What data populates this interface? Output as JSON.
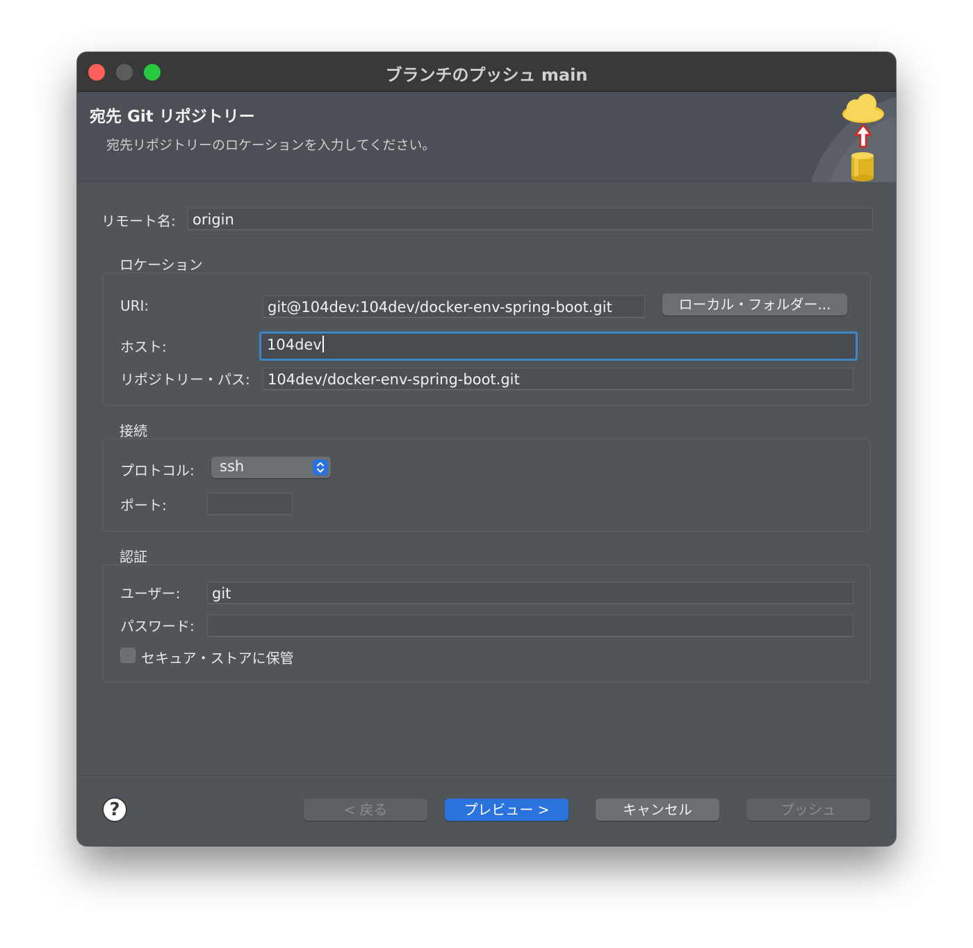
{
  "window": {
    "title": "ブランチのプッシュ main"
  },
  "header": {
    "title": "宛先 Git リポジトリー",
    "description": "宛先リポジトリーのロケーションを入力してください。"
  },
  "remote": {
    "label": "リモート名:",
    "value": "origin"
  },
  "location": {
    "group_title": "ロケーション",
    "uri_label": "URI:",
    "uri_value": "git@104dev:104dev/docker-env-spring-boot.git",
    "local_folder_button": "ローカル・フォルダー...",
    "host_label": "ホスト:",
    "host_value": "104dev",
    "repo_path_label": "リポジトリー・パス:",
    "repo_path_value": "104dev/docker-env-spring-boot.git"
  },
  "connection": {
    "group_title": "接続",
    "protocol_label": "プロトコル:",
    "protocol_value": "ssh",
    "port_label": "ポート:",
    "port_value": ""
  },
  "auth": {
    "group_title": "認証",
    "user_label": "ユーザー:",
    "user_value": "git",
    "password_label": "パスワード:",
    "password_value": "",
    "secure_store_label": "セキュア・ストアに保管",
    "secure_store_checked": false
  },
  "footer": {
    "back_button": "< 戻る",
    "preview_button": "プレビュー >",
    "cancel_button": "キャンセル",
    "push_button": "プッシュ"
  },
  "colors": {
    "accent": "#2a73df",
    "focus_ring": "#3f86c6",
    "close": "#fe5f57",
    "minimize": "#5b5b5b",
    "maximize": "#28c840"
  },
  "icons": {
    "header": "cloud-upload-repository-icon",
    "help": "help-icon",
    "select": "chevron-up-down-icon"
  }
}
